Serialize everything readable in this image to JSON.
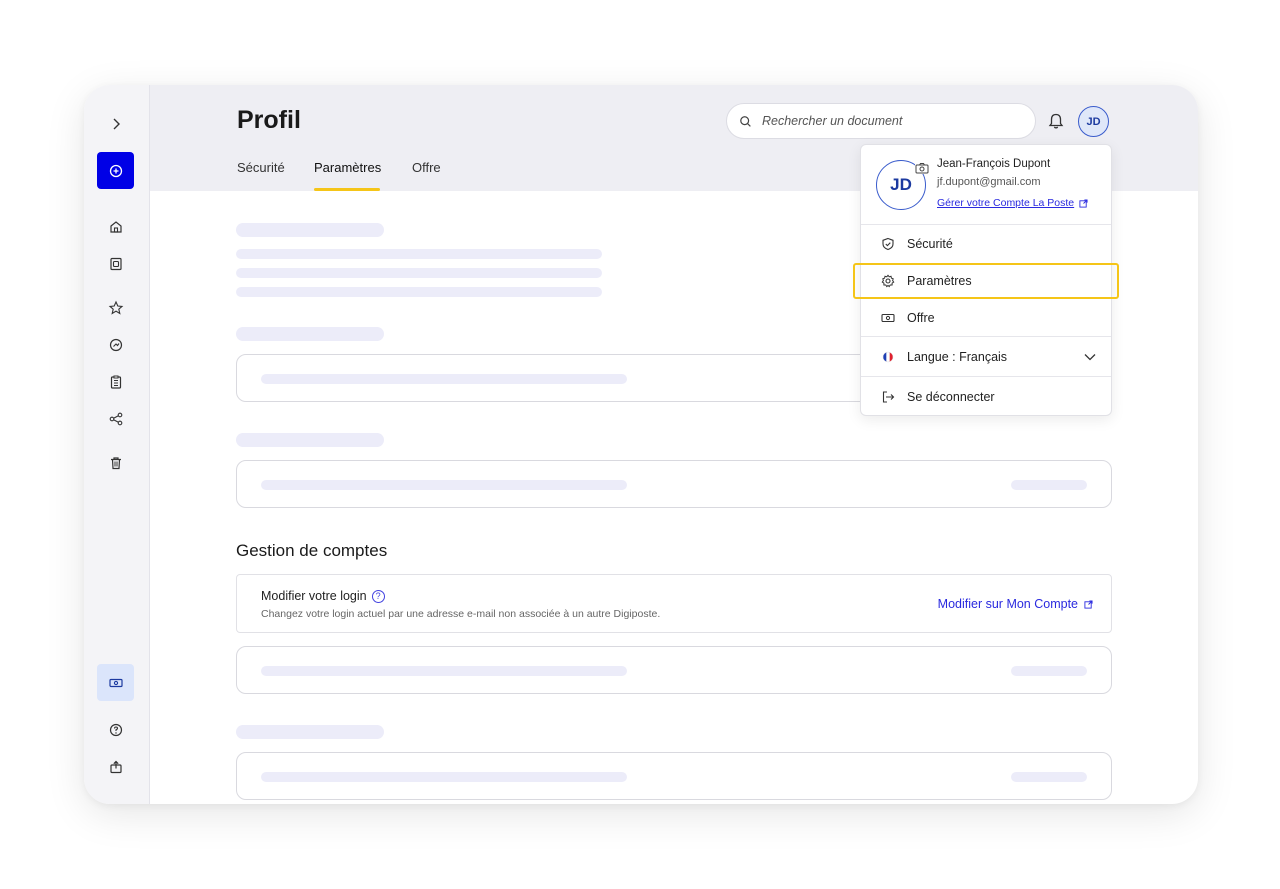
{
  "header": {
    "title": "Profil",
    "tabs": [
      {
        "label": "Sécurité"
      },
      {
        "label": "Paramètres"
      },
      {
        "label": "Offre"
      }
    ],
    "search_placeholder": "Rechercher un document",
    "avatar_initials": "JD"
  },
  "sidebar": {
    "items": [
      "expand-icon",
      "add-icon",
      "home-icon",
      "documents-icon",
      "star-icon",
      "share-drive-icon",
      "clipboard-icon",
      "share-icon",
      "trash-icon",
      "offer-icon",
      "help-icon",
      "export-icon"
    ]
  },
  "account": {
    "section_title": "Gestion de comptes",
    "login_title": "Modifier votre login",
    "login_desc": "Changez votre login actuel par une adresse e-mail non associée à un autre Digiposte.",
    "login_link": "Modifier sur Mon Compte"
  },
  "menu": {
    "avatar_initials": "JD",
    "user_name": "Jean-François Dupont",
    "user_email": "jf.dupont@gmail.com",
    "manage_link": "Gérer votre Compte La Poste",
    "items": [
      {
        "label": "Sécurité",
        "icon": "shield-icon"
      },
      {
        "label": "Paramètres",
        "icon": "gear-icon"
      },
      {
        "label": "Offre",
        "icon": "ticket-icon"
      },
      {
        "label": "Langue : Français",
        "icon": "flag-fr-icon"
      },
      {
        "label": "Se déconnecter",
        "icon": "logout-icon"
      }
    ]
  },
  "colors": {
    "accent": "#0000e6",
    "highlight": "#f5c518",
    "link": "#2a2adf"
  }
}
